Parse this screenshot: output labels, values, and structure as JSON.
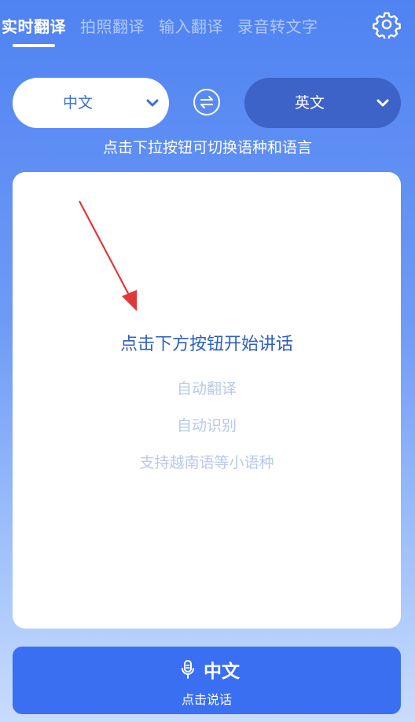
{
  "tabs": [
    {
      "label": "实时翻译",
      "active": true
    },
    {
      "label": "拍照翻译",
      "active": false
    },
    {
      "label": "输入翻译",
      "active": false
    },
    {
      "label": "录音转文字",
      "active": false
    }
  ],
  "language": {
    "source": "中文",
    "target": "英文"
  },
  "hint": "点击下拉按钮可切换语种和语言",
  "card": {
    "prompt": "点击下方按钮开始讲话",
    "features": [
      "自动翻译",
      "自动识别",
      "支持越南语等小语种"
    ]
  },
  "speak_button": {
    "language": "中文",
    "action": "点击说话"
  },
  "colors": {
    "accent": "#3a6ff1",
    "target_pill": "#3d63c8",
    "prompt_text": "#2f5fbf",
    "arrow": "#e0383a"
  },
  "icons": [
    "gear-icon",
    "chevron-down-icon",
    "swap-icon",
    "microphone-icon",
    "annotation-arrow"
  ]
}
